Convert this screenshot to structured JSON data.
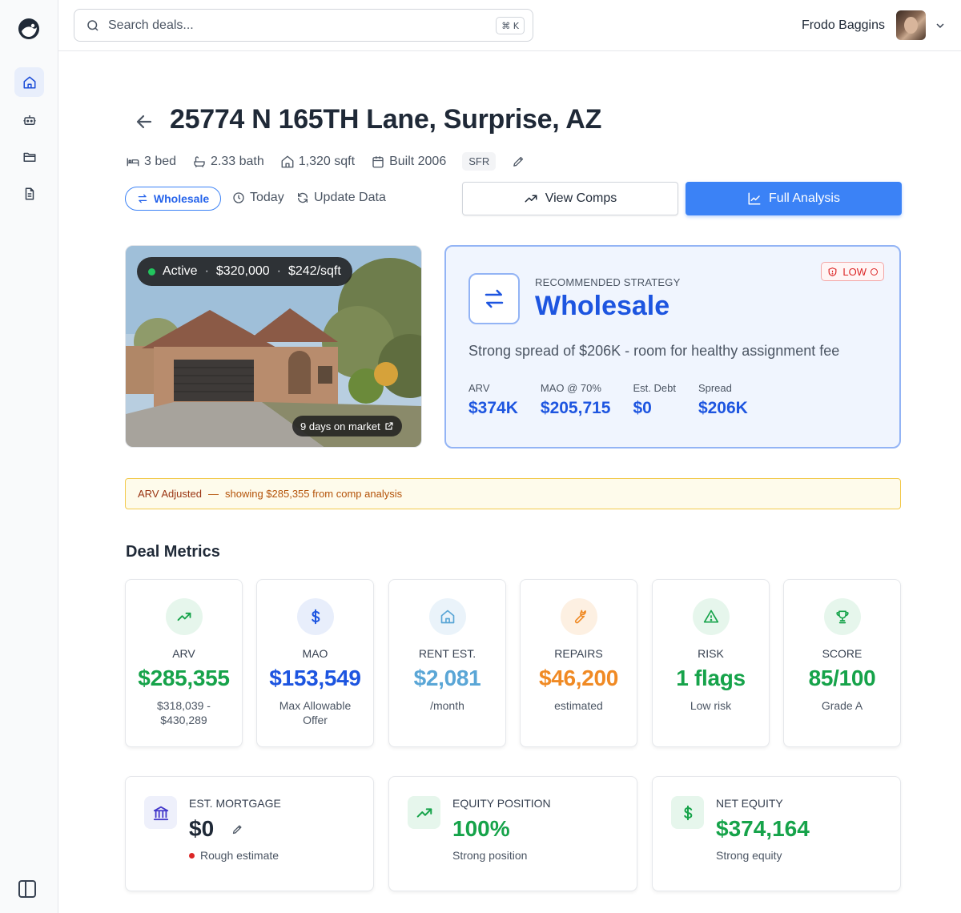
{
  "search": {
    "placeholder": "Search deals...",
    "shortcut": "⌘ K"
  },
  "user": {
    "name": "Frodo Baggins"
  },
  "sidebar": {
    "items": [
      {
        "icon": "home-icon",
        "active": true
      },
      {
        "icon": "bot-icon",
        "active": false
      },
      {
        "icon": "folder-icon",
        "active": false
      },
      {
        "icon": "document-icon",
        "active": false
      }
    ]
  },
  "property": {
    "address": "25774 N 165TH Lane, Surprise, AZ",
    "beds": "3 bed",
    "baths": "2.33 bath",
    "sqft": "1,320 sqft",
    "built": "Built 2006",
    "type": "SFR"
  },
  "actions": {
    "strategy_pill": "Wholesale",
    "date": "Today",
    "update": "Update Data",
    "view_comps": "View Comps",
    "full_analysis": "Full Analysis"
  },
  "listing": {
    "status": "Active",
    "price": "$320,000",
    "price_per_sqft": "$242/sqft",
    "days_on_market": "9 days on market"
  },
  "strategy": {
    "label": "RECOMMENDED STRATEGY",
    "name": "Wholesale",
    "risk": "LOW",
    "description": "Strong spread of $206K - room for healthy assignment fee",
    "stats": [
      {
        "label": "ARV",
        "value": "$374K"
      },
      {
        "label": "MAO @ 70%",
        "value": "$205,715"
      },
      {
        "label": "Est. Debt",
        "value": "$0"
      },
      {
        "label": "Spread",
        "value": "$206K"
      }
    ]
  },
  "alert": {
    "title": "ARV Adjusted",
    "dash": "—",
    "text": "showing $285,355 from comp analysis"
  },
  "metrics": {
    "title": "Deal Metrics",
    "cards": [
      {
        "label": "ARV",
        "value": "$285,355",
        "sub": "$318,039 - $430,289",
        "color": "#16a34a",
        "icon": "trending-up-icon"
      },
      {
        "label": "MAO",
        "value": "$153,549",
        "sub": "Max Allowable Offer",
        "color": "#1d55e0",
        "icon": "dollar-icon"
      },
      {
        "label": "RENT EST.",
        "value": "$2,081",
        "sub": "/month",
        "color": "#5aa6d6",
        "icon": "house-icon"
      },
      {
        "label": "REPAIRS",
        "value": "$46,200",
        "sub": "estimated",
        "color": "#f08a24",
        "icon": "wrench-icon"
      },
      {
        "label": "RISK",
        "value": "1 flags",
        "sub": "Low risk",
        "color": "#16a34a",
        "icon": "warning-icon"
      },
      {
        "label": "SCORE",
        "value": "85/100",
        "sub": "Grade A",
        "color": "#16a34a",
        "icon": "trophy-icon"
      }
    ]
  },
  "summary": {
    "mortgage": {
      "label": "EST. MORTGAGE",
      "value": "$0",
      "sub": "Rough estimate"
    },
    "equity_position": {
      "label": "EQUITY POSITION",
      "value": "100%",
      "sub": "Strong position"
    },
    "net_equity": {
      "label": "NET EQUITY",
      "value": "$374,164",
      "sub": "Strong equity"
    }
  }
}
